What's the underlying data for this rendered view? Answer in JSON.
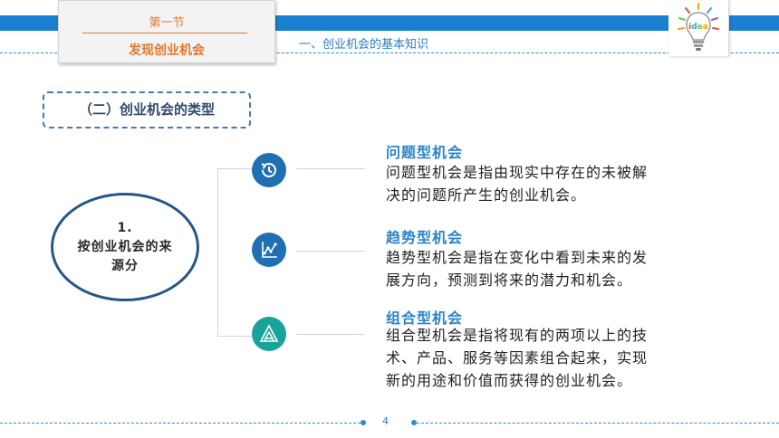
{
  "header": {
    "section": "第一节",
    "section_title": "发现创业机会",
    "subtitle": "一、创业机会的基本知识",
    "logo_text": "idea"
  },
  "topic": {
    "label": "（二）创业机会的类型"
  },
  "category": {
    "line1": "1.",
    "line2": "按创业机会的来",
    "line3": "源分"
  },
  "items": [
    {
      "icon": "history-clock-icon",
      "title": "问题型机会",
      "desc_line1": "问题型机会是指由现实中存在的未被解",
      "desc_line2": "决的问题所产生的创业机会。"
    },
    {
      "icon": "line-chart-icon",
      "title": "趋势型机会",
      "desc_line1": "趋势型机会是指在变化中看到未来的发",
      "desc_line2": "展方向，预测到将来的潜力和机会。"
    },
    {
      "icon": "triangle-structure-icon",
      "title": "组合型机会",
      "desc_line1": "组合型机会是指将现有的两项以上的技",
      "desc_line2": "术、产品、服务等因素组合起来，实现",
      "desc_line3": "新的用途和价值而获得的创业机会。"
    }
  ],
  "footer": {
    "page": "4"
  },
  "colors": {
    "header_blue": "#1a7fd0",
    "accent_orange": "#e0792f",
    "dark_navy": "#25578a",
    "icon_blue": "#1f6fb2",
    "icon_teal": "#1aa39a",
    "title_blue": "#2b84c6"
  }
}
